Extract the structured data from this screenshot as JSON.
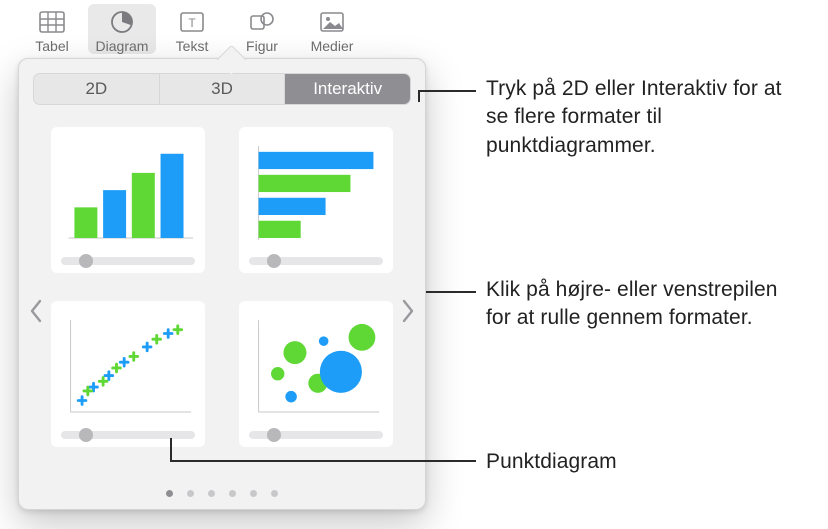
{
  "toolbar": {
    "items": [
      {
        "label": "Tabel",
        "name": "table-icon"
      },
      {
        "label": "Diagram",
        "name": "chart-icon"
      },
      {
        "label": "Tekst",
        "name": "text-icon"
      },
      {
        "label": "Figur",
        "name": "shape-icon"
      },
      {
        "label": "Medier",
        "name": "media-icon"
      }
    ],
    "active_index": 1
  },
  "panel": {
    "segments": [
      "2D",
      "3D",
      "Interaktiv"
    ],
    "selected_segment_index": 2,
    "pages": 6,
    "active_page_index": 0,
    "thumbs": [
      {
        "name": "column-chart-thumb"
      },
      {
        "name": "bar-chart-thumb"
      },
      {
        "name": "scatter-chart-thumb"
      },
      {
        "name": "bubble-chart-thumb"
      }
    ]
  },
  "callouts": {
    "c1": "Tryk på 2D eller Interaktiv for at se flere formater til punktdiagrammer.",
    "c2": "Klik på højre- eller venstrepilen for at rulle gennem formater.",
    "c3": "Punktdiagram"
  },
  "colors": {
    "blue": "#1d9df7",
    "green": "#5fd835",
    "track": "#e6e6e8"
  }
}
